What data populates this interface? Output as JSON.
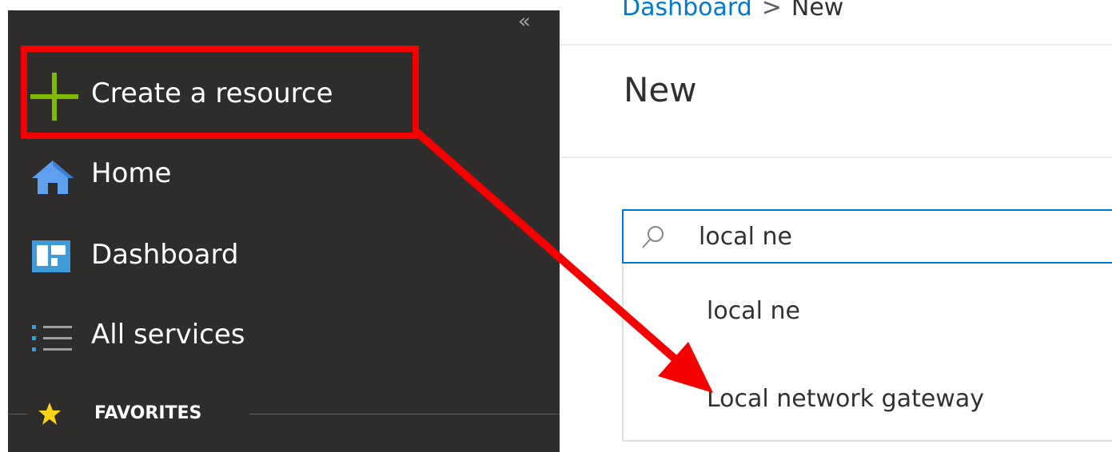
{
  "sidebar": {
    "collapse_glyph": "«",
    "items": [
      {
        "label": "Create a resource",
        "icon": "plus-icon"
      },
      {
        "label": "Home",
        "icon": "home-icon"
      },
      {
        "label": "Dashboard",
        "icon": "dashboard-icon"
      },
      {
        "label": "All services",
        "icon": "list-icon"
      }
    ],
    "favorites_label": "FAVORITES"
  },
  "main": {
    "breadcrumb": {
      "link": "Dashboard",
      "separator": ">",
      "current": "New"
    },
    "title": "New",
    "search": {
      "value": "local ne",
      "icon": "search-icon"
    },
    "suggestions": [
      "local ne",
      "Local network gateway"
    ]
  },
  "colors": {
    "sidebar_bg": "#2f2d2c",
    "accent": "#0078d4",
    "plus_green": "#7fba00",
    "star_yellow": "#fcd116",
    "annotation_red": "#f50000"
  }
}
